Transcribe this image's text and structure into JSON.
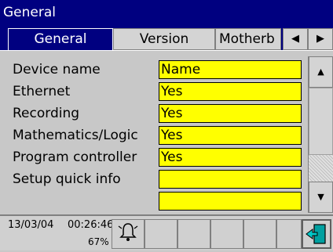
{
  "window": {
    "title": "General"
  },
  "tabs": [
    {
      "label": "General",
      "active": true
    },
    {
      "label": "Version",
      "active": false
    },
    {
      "label": "Motherb",
      "active": false
    }
  ],
  "tab_arrows": {
    "left": "◀",
    "right": "▶"
  },
  "fields": [
    {
      "label": "Device name",
      "value": "Name"
    },
    {
      "label": "Ethernet",
      "value": "Yes"
    },
    {
      "label": "Recording",
      "value": "Yes"
    },
    {
      "label": "Mathematics/Logic",
      "value": "Yes"
    },
    {
      "label": "Program controller",
      "value": "Yes"
    },
    {
      "label": "Setup quick info",
      "value": ""
    },
    {
      "label": "",
      "value": ""
    }
  ],
  "scrollbar": {
    "up": "▲",
    "down": "▼"
  },
  "status": {
    "date": "13/03/04",
    "time": "00:26:46",
    "memory_percent": "67%"
  },
  "colors": {
    "header": "#000080",
    "field": "#ffff00",
    "panel": "#c8c8c8"
  }
}
